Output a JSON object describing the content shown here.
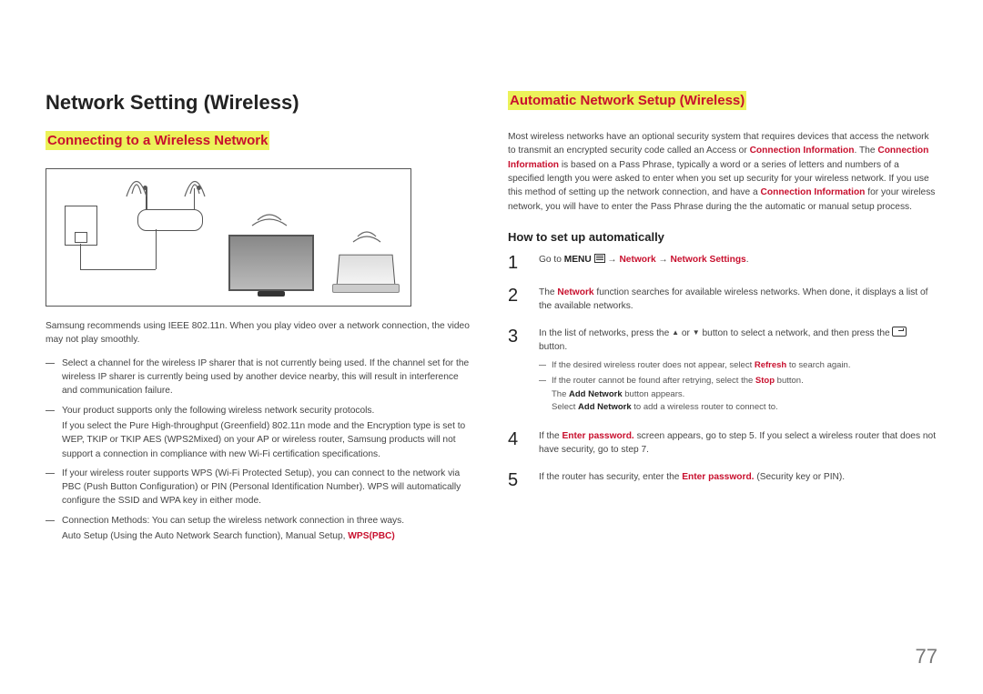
{
  "page_number": "77",
  "left": {
    "title": "Network Setting (Wireless)",
    "subtitle": "Connecting to a Wireless Network",
    "intro": "Samsung recommends using IEEE 802.11n. When you play video over a network connection, the video may not play smoothly.",
    "bullets": [
      {
        "text": "Select a channel for the wireless IP sharer that is not currently being used. If the channel set for the wireless IP sharer is currently being used by another device nearby, this will result in interference and communication failure."
      },
      {
        "text": "Your product supports only the following wireless network security protocols.",
        "indent": "If you select the Pure High-throughput (Greenfield) 802.11n mode and the Encryption type is set to WEP, TKIP or TKIP AES (WPS2Mixed) on your AP or wireless router, Samsung products will not support a connection in compliance with new Wi-Fi certification specifications."
      },
      {
        "text": "If your wireless router supports WPS (Wi-Fi Protected Setup), you can connect to the network via PBC (Push Button Configuration) or PIN (Personal Identification Number). WPS will automatically configure the SSID and WPA key in either mode."
      },
      {
        "text": "Connection Methods: You can setup the wireless network connection in three ways.",
        "indent_prefix": "Auto Setup (Using the Auto Network Search function), Manual Setup, ",
        "indent_red": "WPS(PBC)"
      }
    ]
  },
  "right": {
    "subtitle": "Automatic Network Setup (Wireless)",
    "para_pre": "Most wireless networks have an optional security system that requires devices that access the network to transmit an encrypted security code called an Access or ",
    "conn_info": "Connection Information",
    "para_mid1": ". The ",
    "para_mid2": " is based on a Pass Phrase, typically a word or a series of letters and numbers of a specified length you were asked to enter when you set up security for your wireless network. If you use this method of setting up the network connection, and have a ",
    "para_post": " for your wireless network, you will have to enter the Pass Phrase during the the automatic or manual setup process.",
    "howto": "How to set up automatically",
    "step1_pre": "Go to ",
    "step1_menu": "MENU ",
    "step1_arrow": " → ",
    "step1_net": "Network",
    "step1_netset": "Network Settings",
    "step1_dot": ".",
    "step2_pre": "The ",
    "step2_net": "Network",
    "step2_post": " function searches for available wireless networks. When done, it displays a list of the available networks.",
    "step3": "In the list of networks, press the ▲ or ▼ button to select a network, and then press the ",
    "step3_end": " button.",
    "step3_sub1_pre": "If the desired wireless router does not appear, select ",
    "step3_sub1_refresh": "Refresh",
    "step3_sub1_post": " to search again.",
    "step3_sub2_pre": "If the router cannot be found after retrying, select the ",
    "step3_sub2_stop": "Stop",
    "step3_sub2_post": " button.",
    "step3_sub3_pre": "The ",
    "step3_sub3_add": "Add Network",
    "step3_sub3_post": " button appears.",
    "step3_sub4_pre": "Select ",
    "step3_sub4_add": "Add Network",
    "step3_sub4_post": " to add a wireless router to connect to.",
    "step4_pre": "If the ",
    "step4_enter": "Enter password.",
    "step4_post": " screen appears, go to step 5. If you select a wireless router that does not have security, go to step 7.",
    "step5_pre": "If the router has security, enter the ",
    "step5_enter": "Enter password.",
    "step5_post": " (Security key or PIN)."
  }
}
